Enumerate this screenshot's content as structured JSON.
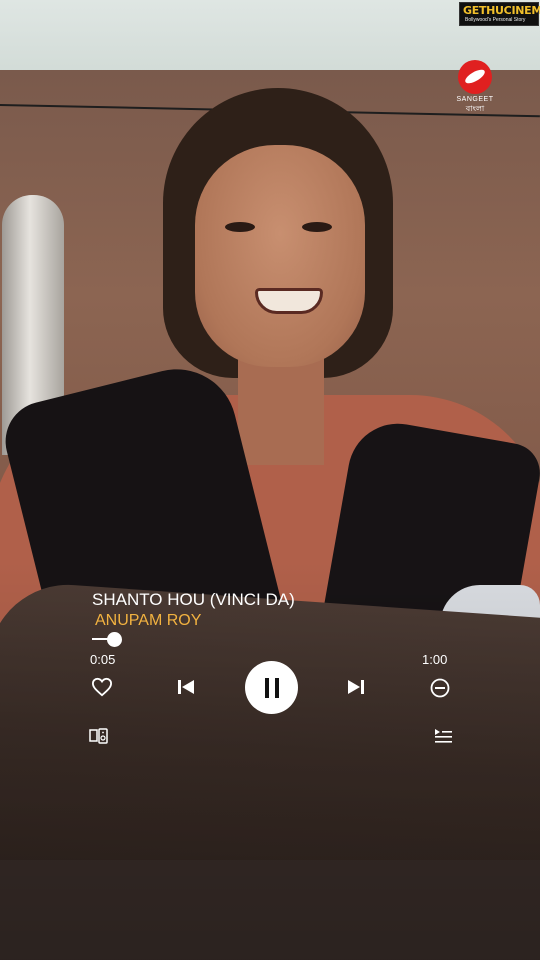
{
  "watermark": {
    "brand": "GETHUCINEMA",
    "tagline": "Bollywood's Personal Story"
  },
  "channel_logo": {
    "line1": "SANGEET",
    "line2": "বাংলা",
    "color": "#e02020"
  },
  "player": {
    "song_title": "SHANTO HOU (VINCI DA)",
    "artist": "ANUPAM ROY",
    "elapsed": "0:05",
    "total": "1:00",
    "progress_fraction": 0.083,
    "state": "playing",
    "accent_color": "#f2b240",
    "icons": [
      "heart-icon",
      "previous-icon",
      "pause-icon",
      "next-icon",
      "remove-icon",
      "device-speaker-icon",
      "queue-icon"
    ]
  }
}
